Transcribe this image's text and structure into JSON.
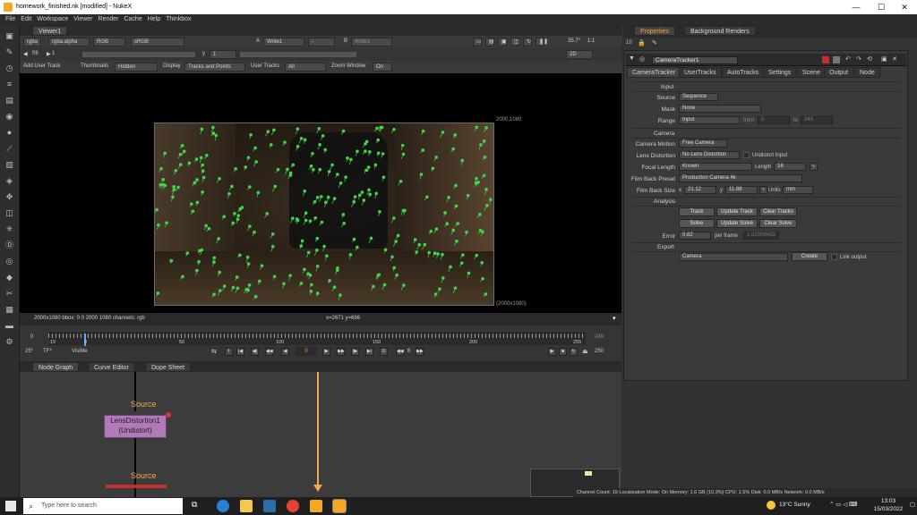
{
  "window": {
    "title": "homework_finished.nk [modified] - NukeX",
    "minimize": "—",
    "maximize": "☐",
    "close": "✕"
  },
  "menu": [
    "File",
    "Edit",
    "Workspace",
    "Viewer",
    "Render",
    "Cache",
    "Help",
    "Thinkbox"
  ],
  "viewer": {
    "tab": "Viewer1",
    "ctl1": {
      "channels": "rgba",
      "alpha": "rgba.alpha",
      "colorspace_a": "RGB",
      "lut": "sRGB",
      "input_a_label": "A",
      "input_a": "Write1",
      "input_mid": "-",
      "input_b_label": "B",
      "input_b": "Write1",
      "gain": "35.7°",
      "zoom": "1:1"
    },
    "ctl2": {
      "fstop": "f/8",
      "frame_label": "1",
      "y_label": "y",
      "y_value": "1",
      "mode": "2D"
    },
    "ctl3": {
      "add_user_track": "Add User Track",
      "thumbnails_label": "Thumbnails",
      "thumbnails": "Hidden",
      "display_label": "Display",
      "display": "Tracks and Points",
      "user_tracks_label": "User Tracks",
      "user_tracks": "All",
      "zoom_window_label": "Zoom Window",
      "zoom_window": "On"
    },
    "format_top": "2000,1080",
    "format_bottom": "(2000x1080)",
    "status_left": "2000x1080  bbox: 0 0 2000 1080 channels: rgb",
    "status_mid": "x=2671 y=686"
  },
  "timeline": {
    "start": "0",
    "end": "249",
    "ruler_ticks": [
      "-19",
      "0",
      "50",
      "100",
      "150",
      "200",
      "255"
    ],
    "fps": "25*",
    "tf": "TF*",
    "visible": "Visible",
    "current_frame": "0",
    "step": "8",
    "last": "250"
  },
  "nodegraph": {
    "tabs": [
      "Node Graph",
      "Curve Editor",
      "Dope Sheet"
    ],
    "source_label_1": "Source",
    "node_name": "LensDistortion1",
    "node_mode": "(Undistort)",
    "source_label_2": "Source"
  },
  "properties": {
    "tabs": [
      "Properties",
      "Background Renders"
    ],
    "count": "10",
    "node_title": "CameraTracker1",
    "subtabs": [
      "CameraTracker",
      "UserTracks",
      "AutoTracks",
      "Settings",
      "Scene",
      "Output",
      "Node"
    ],
    "input_section": "Input",
    "source_label": "Source",
    "source_value": "Sequence",
    "mask_label": "Mask",
    "mask_value": "None",
    "range_label": "Range",
    "range_value": "Input",
    "range_from_label": "from",
    "range_from": "0",
    "range_to_label": "to",
    "range_to": "249",
    "camera_section": "Camera",
    "motion_label": "Camera Motion",
    "motion_value": "Free Camera",
    "lensdist_label": "Lens Distortion",
    "lensdist_value": "No Lens Distortion",
    "undistort_input": "Undistort Input",
    "focal_label": "Focal Length",
    "focal_value": "Known",
    "length_label": "Length",
    "length_value": "16",
    "filmback_preset_label": "Film Back Preset",
    "filmback_preset": "Production Camera 4k",
    "filmback_size_label": "Film Back Size",
    "fb_x_label": "x",
    "fb_x": "21.12",
    "fb_y_label": "y",
    "fb_y": "11.88",
    "units_label": "Units",
    "units": "mm",
    "analysis_section": "Analysis",
    "track_btn": "Track",
    "update_track_btn": "Update Track",
    "clear_tracks_btn": "Clear Tracks",
    "solve_btn": "Solve",
    "update_solve_btn": "Update Solve",
    "clear_solve_btn": "Clear Solve",
    "error_label": "Error",
    "error_value": "0.82",
    "per_frame_label": "per frame",
    "per_frame_value": "1.02009433",
    "export_section": "Export",
    "export_value": "Camera",
    "create_btn": "Create",
    "link_output": "Link output"
  },
  "status_strip": "Channel Count: 19  Localization Mode: On  Memory: 1.6 GB (10.3%)  CPU: 1.5%  Disk: 0.0 MB/s  Network: 0.0 MB/s",
  "taskbar": {
    "search_placeholder": "Type here to search",
    "weather": "13°C  Sunny",
    "time": "13:03",
    "date": "15/03/2022"
  },
  "colors": {
    "accent": "#f5a623",
    "track_point": "#3fd64a",
    "node_purple": "#b07ab8"
  }
}
